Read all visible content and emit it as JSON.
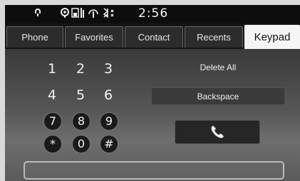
{
  "status": {
    "time": "2:56",
    "icons": [
      "bluetooth-audio-icon",
      "voice-icon",
      "phone-battery-icon",
      "signal-icon",
      "bluetooth-icon"
    ]
  },
  "tabs": [
    {
      "label": "Phone"
    },
    {
      "label": "Favorites"
    },
    {
      "label": "Contact"
    },
    {
      "label": "Recents"
    },
    {
      "label": "Keypad"
    }
  ],
  "active_tab": "Keypad",
  "keypad": {
    "keys": [
      "1",
      "2",
      "3",
      "4",
      "5",
      "6",
      "7",
      "8",
      "9",
      "*",
      "0",
      "#"
    ]
  },
  "actions": {
    "delete_all": "Delete All",
    "backspace": "Backspace",
    "call_icon": "phone-icon"
  },
  "entry": {
    "value": ""
  },
  "colors": {
    "active_tab": "#f5f5f5",
    "background": "#2a2a2a",
    "statusbar": "#0d0d0d"
  }
}
